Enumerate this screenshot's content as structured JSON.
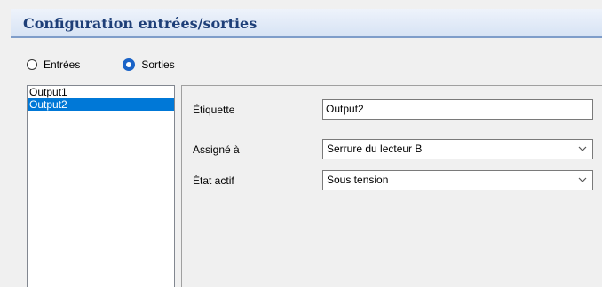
{
  "header": {
    "title": "Configuration entrées/sorties"
  },
  "mode": {
    "options": [
      {
        "label": "Entrées",
        "selected": false
      },
      {
        "label": "Sorties",
        "selected": true
      }
    ]
  },
  "list": {
    "items": [
      {
        "label": "Output1",
        "selected": false
      },
      {
        "label": "Output2",
        "selected": true
      }
    ]
  },
  "details": {
    "label_field": {
      "label": "Étiquette",
      "value": "Output2"
    },
    "assigned_field": {
      "label": "Assigné à",
      "value": "Serrure du lecteur B"
    },
    "state_field": {
      "label": "État actif",
      "value": "Sous tension"
    }
  },
  "colors": {
    "header_text": "#1e3f78",
    "selection": "#0078d7",
    "radio_selected": "#1a63c7"
  },
  "icons": {
    "dropdown": "chevron-down-icon"
  }
}
